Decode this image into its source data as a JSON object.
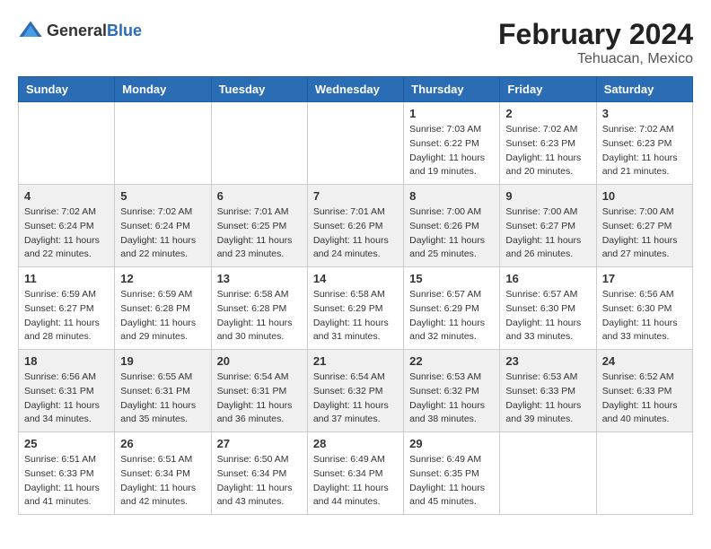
{
  "header": {
    "logo_general": "General",
    "logo_blue": "Blue",
    "title": "February 2024",
    "subtitle": "Tehuacan, Mexico"
  },
  "weekdays": [
    "Sunday",
    "Monday",
    "Tuesday",
    "Wednesday",
    "Thursday",
    "Friday",
    "Saturday"
  ],
  "weeks": [
    [
      {
        "day": "",
        "info": ""
      },
      {
        "day": "",
        "info": ""
      },
      {
        "day": "",
        "info": ""
      },
      {
        "day": "",
        "info": ""
      },
      {
        "day": "1",
        "info": "Sunrise: 7:03 AM\nSunset: 6:22 PM\nDaylight: 11 hours\nand 19 minutes."
      },
      {
        "day": "2",
        "info": "Sunrise: 7:02 AM\nSunset: 6:23 PM\nDaylight: 11 hours\nand 20 minutes."
      },
      {
        "day": "3",
        "info": "Sunrise: 7:02 AM\nSunset: 6:23 PM\nDaylight: 11 hours\nand 21 minutes."
      }
    ],
    [
      {
        "day": "4",
        "info": "Sunrise: 7:02 AM\nSunset: 6:24 PM\nDaylight: 11 hours\nand 22 minutes."
      },
      {
        "day": "5",
        "info": "Sunrise: 7:02 AM\nSunset: 6:24 PM\nDaylight: 11 hours\nand 22 minutes."
      },
      {
        "day": "6",
        "info": "Sunrise: 7:01 AM\nSunset: 6:25 PM\nDaylight: 11 hours\nand 23 minutes."
      },
      {
        "day": "7",
        "info": "Sunrise: 7:01 AM\nSunset: 6:26 PM\nDaylight: 11 hours\nand 24 minutes."
      },
      {
        "day": "8",
        "info": "Sunrise: 7:00 AM\nSunset: 6:26 PM\nDaylight: 11 hours\nand 25 minutes."
      },
      {
        "day": "9",
        "info": "Sunrise: 7:00 AM\nSunset: 6:27 PM\nDaylight: 11 hours\nand 26 minutes."
      },
      {
        "day": "10",
        "info": "Sunrise: 7:00 AM\nSunset: 6:27 PM\nDaylight: 11 hours\nand 27 minutes."
      }
    ],
    [
      {
        "day": "11",
        "info": "Sunrise: 6:59 AM\nSunset: 6:27 PM\nDaylight: 11 hours\nand 28 minutes."
      },
      {
        "day": "12",
        "info": "Sunrise: 6:59 AM\nSunset: 6:28 PM\nDaylight: 11 hours\nand 29 minutes."
      },
      {
        "day": "13",
        "info": "Sunrise: 6:58 AM\nSunset: 6:28 PM\nDaylight: 11 hours\nand 30 minutes."
      },
      {
        "day": "14",
        "info": "Sunrise: 6:58 AM\nSunset: 6:29 PM\nDaylight: 11 hours\nand 31 minutes."
      },
      {
        "day": "15",
        "info": "Sunrise: 6:57 AM\nSunset: 6:29 PM\nDaylight: 11 hours\nand 32 minutes."
      },
      {
        "day": "16",
        "info": "Sunrise: 6:57 AM\nSunset: 6:30 PM\nDaylight: 11 hours\nand 33 minutes."
      },
      {
        "day": "17",
        "info": "Sunrise: 6:56 AM\nSunset: 6:30 PM\nDaylight: 11 hours\nand 33 minutes."
      }
    ],
    [
      {
        "day": "18",
        "info": "Sunrise: 6:56 AM\nSunset: 6:31 PM\nDaylight: 11 hours\nand 34 minutes."
      },
      {
        "day": "19",
        "info": "Sunrise: 6:55 AM\nSunset: 6:31 PM\nDaylight: 11 hours\nand 35 minutes."
      },
      {
        "day": "20",
        "info": "Sunrise: 6:54 AM\nSunset: 6:31 PM\nDaylight: 11 hours\nand 36 minutes."
      },
      {
        "day": "21",
        "info": "Sunrise: 6:54 AM\nSunset: 6:32 PM\nDaylight: 11 hours\nand 37 minutes."
      },
      {
        "day": "22",
        "info": "Sunrise: 6:53 AM\nSunset: 6:32 PM\nDaylight: 11 hours\nand 38 minutes."
      },
      {
        "day": "23",
        "info": "Sunrise: 6:53 AM\nSunset: 6:33 PM\nDaylight: 11 hours\nand 39 minutes."
      },
      {
        "day": "24",
        "info": "Sunrise: 6:52 AM\nSunset: 6:33 PM\nDaylight: 11 hours\nand 40 minutes."
      }
    ],
    [
      {
        "day": "25",
        "info": "Sunrise: 6:51 AM\nSunset: 6:33 PM\nDaylight: 11 hours\nand 41 minutes."
      },
      {
        "day": "26",
        "info": "Sunrise: 6:51 AM\nSunset: 6:34 PM\nDaylight: 11 hours\nand 42 minutes."
      },
      {
        "day": "27",
        "info": "Sunrise: 6:50 AM\nSunset: 6:34 PM\nDaylight: 11 hours\nand 43 minutes."
      },
      {
        "day": "28",
        "info": "Sunrise: 6:49 AM\nSunset: 6:34 PM\nDaylight: 11 hours\nand 44 minutes."
      },
      {
        "day": "29",
        "info": "Sunrise: 6:49 AM\nSunset: 6:35 PM\nDaylight: 11 hours\nand 45 minutes."
      },
      {
        "day": "",
        "info": ""
      },
      {
        "day": "",
        "info": ""
      }
    ]
  ]
}
